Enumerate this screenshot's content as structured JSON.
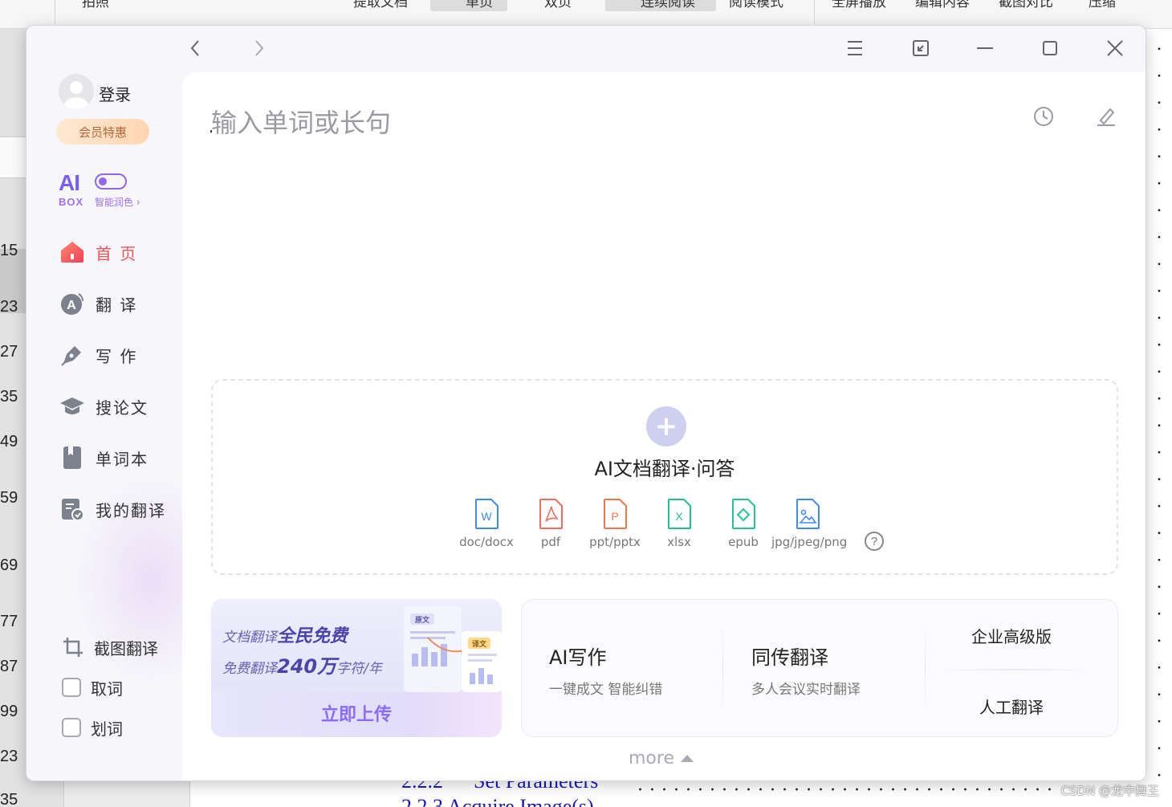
{
  "background": {
    "toolbar": [
      "拍照",
      "提取文档",
      "单页",
      "双页",
      "连续阅读",
      "阅读模式",
      "全屏播放",
      "编辑内容",
      "截图对比",
      "压缩"
    ],
    "line_numbers": [
      "15",
      "23",
      "27",
      "35",
      "49",
      "59",
      "69",
      "77",
      "87",
      "99",
      "23",
      "35"
    ],
    "heading_number": "2.2.2",
    "heading_text": "Set Parameters",
    "subheading": "2.2.3   Acquire Image(s)",
    "watermark": "CSDN @龙中舞王"
  },
  "window": {
    "title_icons": [
      "back-icon",
      "forward-icon",
      "menu-icon",
      "mini-mode-icon",
      "minimize-icon",
      "maximize-icon",
      "close-icon"
    ]
  },
  "sidebar": {
    "login": "登录",
    "vip": "会员特惠",
    "aibox": {
      "ai": "AI",
      "box": "BOX",
      "label": "智能润色 ›"
    },
    "nav": [
      {
        "label": "首 页",
        "icon": "home-icon",
        "active": true
      },
      {
        "label": "翻 译",
        "icon": "translate-icon",
        "active": false
      },
      {
        "label": "写 作",
        "icon": "pen-icon",
        "active": false
      },
      {
        "label": "搜论文",
        "icon": "graduation-cap-icon",
        "active": false
      },
      {
        "label": "单词本",
        "icon": "bookmark-book-icon",
        "active": false
      },
      {
        "label": "我的翻译",
        "icon": "my-translation-icon",
        "active": false
      }
    ],
    "tools": [
      {
        "label": "截图翻译",
        "icon": "crop-icon"
      },
      {
        "label": "取词",
        "checked": false
      },
      {
        "label": "划词",
        "checked": false
      }
    ]
  },
  "main": {
    "search": {
      "placeholder": "输入单词或长句"
    },
    "upload": {
      "title": "AI文档翻译·问答",
      "file_types": [
        {
          "label": "doc/docx",
          "letter": "W",
          "color": "#3d8bf2"
        },
        {
          "label": "pdf",
          "letter": "pdf",
          "color": "#f26d5b"
        },
        {
          "label": "ppt/pptx",
          "letter": "P",
          "color": "#f2784b"
        },
        {
          "label": "xlsx",
          "letter": "X",
          "color": "#20c08a"
        },
        {
          "label": "epub",
          "letter": "e",
          "color": "#23c493"
        },
        {
          "label": "jpg/jpeg/png",
          "letter": "img",
          "color": "#3d8bf2"
        }
      ],
      "help": "?"
    },
    "promo": {
      "line1_prefix": "文档翻译",
      "line1_bold": "全民免费",
      "line2_prefix": "免费翻译",
      "line2_bold": "240万",
      "line2_suffix": "字符/年",
      "illus_source": "原文",
      "illus_target": "译文",
      "cta": "立即上传"
    },
    "features": [
      {
        "title": "AI写作",
        "subtitle": "一键成文 智能纠错"
      },
      {
        "title": "同传翻译",
        "subtitle": "多人会议实时翻译"
      }
    ],
    "side_features": [
      "企业高级版",
      "人工翻译"
    ],
    "more": "more"
  }
}
